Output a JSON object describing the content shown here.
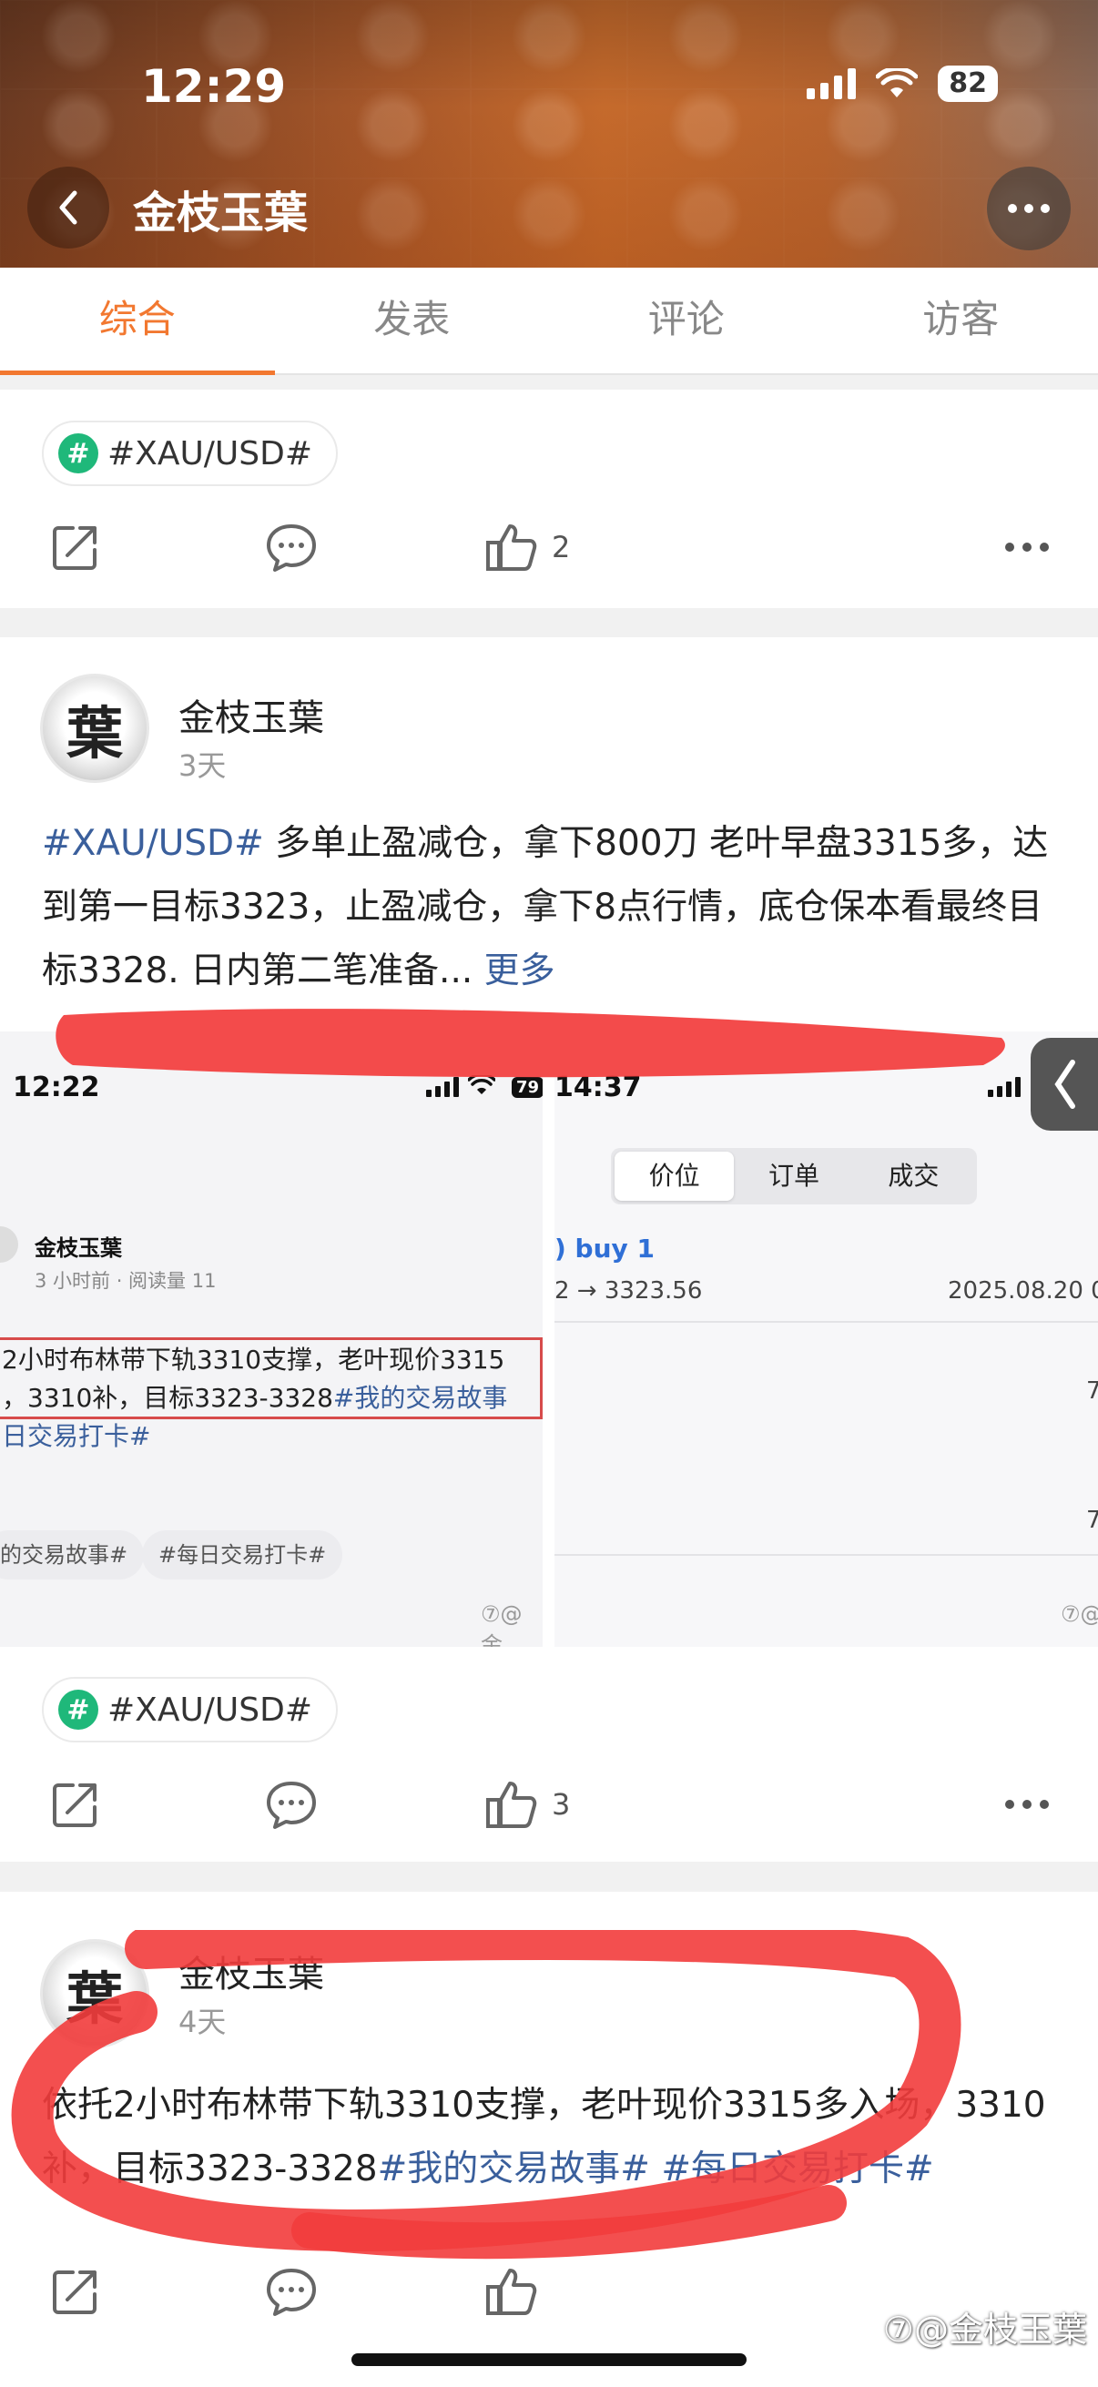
{
  "status_bar": {
    "time": "12:29",
    "battery": "82"
  },
  "header": {
    "title": "金枝玉葉"
  },
  "tabs": [
    {
      "label": "综合",
      "active": true
    },
    {
      "label": "发表",
      "active": false
    },
    {
      "label": "评论",
      "active": false
    },
    {
      "label": "访客",
      "active": false
    }
  ],
  "post0": {
    "topic": "#XAU/USD#",
    "likes": "2"
  },
  "post1": {
    "author": "金枝玉葉",
    "time": "3天",
    "text_tag": "#XAU/USD#",
    "text_body": " 多单止盈减仓，拿下800刀 老叶早盘3315多，达到第一目标3323，止盈减仓，拿下8点行情，底仓保本看最终目标3328. 日内第二笔准备...",
    "more_link": "更多",
    "topic": "#XAU/USD#",
    "likes": "3",
    "shot_left": {
      "time": "12:22",
      "battery": "79",
      "author": "金枝玉葉",
      "meta": "3 小时前 · 阅读量 11",
      "line1": "2小时布林带下轨3310支撑，老叶现价3315",
      "line2_plain": "，3310补，目标3323-3328",
      "line2_tag": "#我的交易故事",
      "line3_tag": "日交易打卡#",
      "pill1": "的交易故事#",
      "pill2": "#每日交易打卡#",
      "watermark": "⑦@金"
    },
    "shot_right": {
      "time": "14:37",
      "seg": [
        "价位",
        "订单",
        "成交"
      ],
      "order_title": ") buy 1",
      "order_price": "2 → 3323.56",
      "order_date": "2025.08.20 0",
      "edge1": "7",
      "edge2": "7",
      "watermark": "⑦@"
    }
  },
  "post2": {
    "author": "金枝玉葉",
    "time": "4天",
    "text_plain": "依托2小时布林带下轨3310支撑，老叶现价3315多入场，3310补，目标3323-3328",
    "text_tags": "#我的交易故事# #每日交易打卡#"
  },
  "footer_watermark": "⑦@金枝玉葉"
}
